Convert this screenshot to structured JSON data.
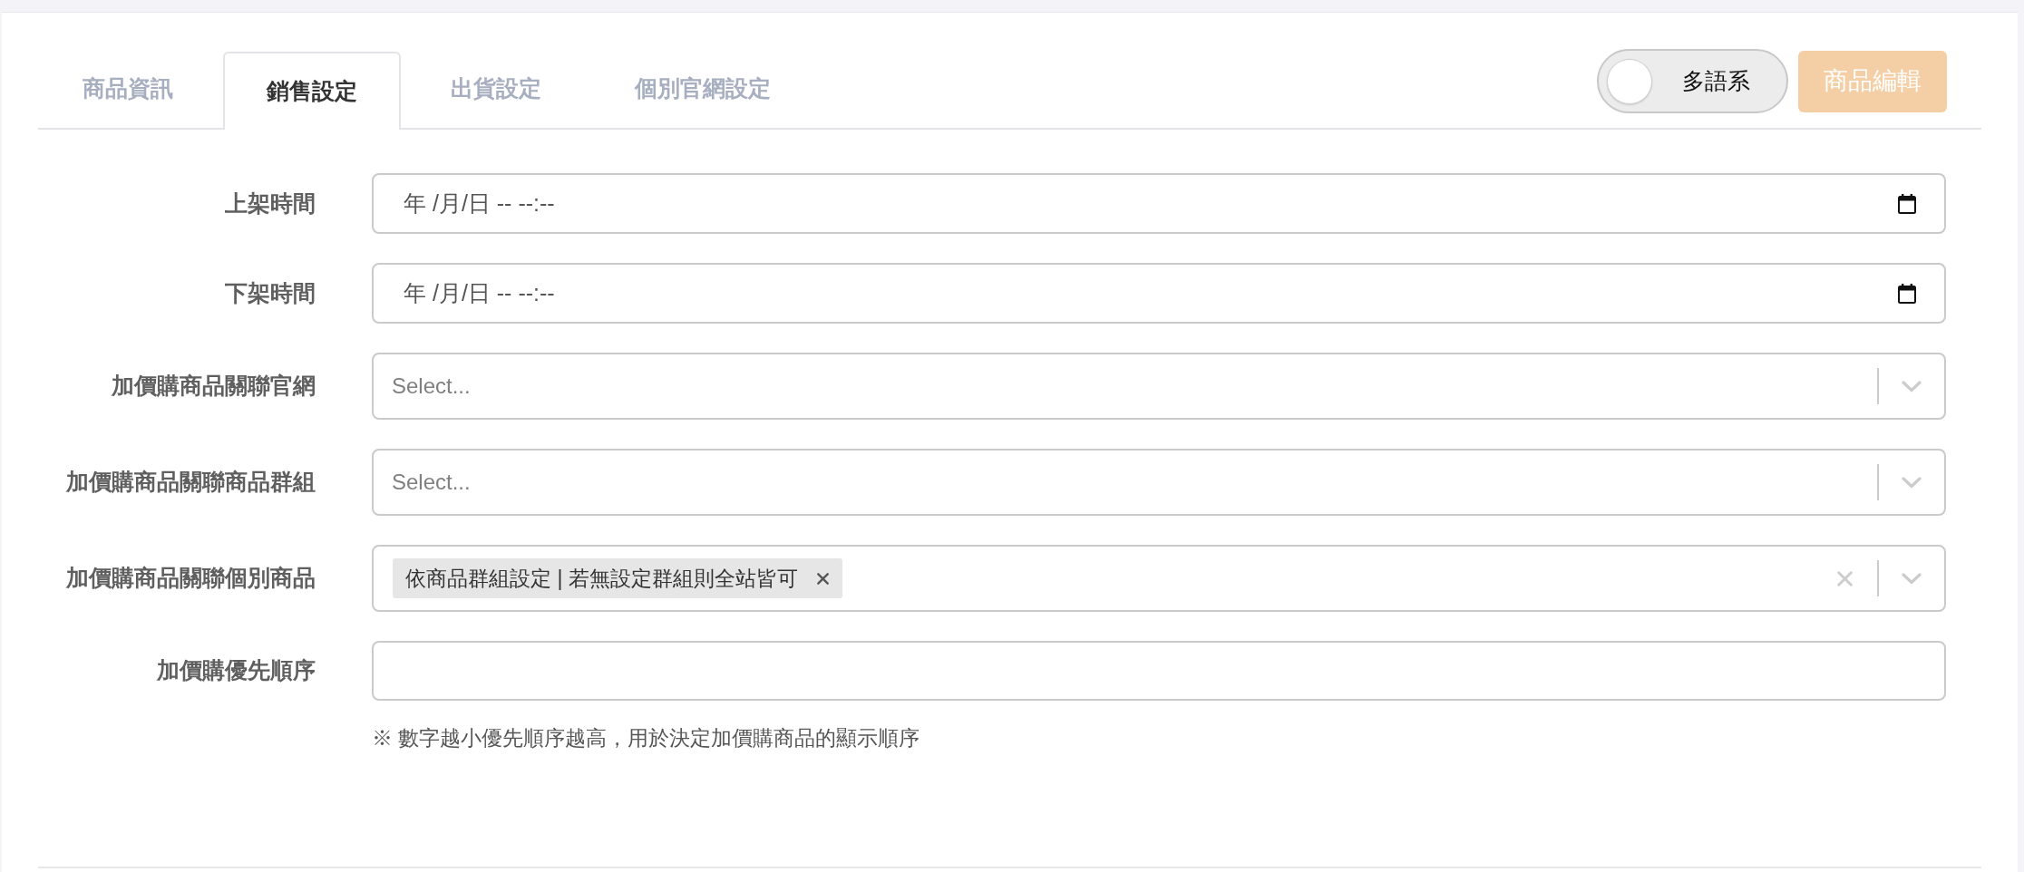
{
  "tabs": [
    {
      "label": "商品資訊",
      "selected": false
    },
    {
      "label": "銷售設定",
      "selected": true
    },
    {
      "label": "出貨設定",
      "selected": false
    },
    {
      "label": "個別官網設定",
      "selected": false
    }
  ],
  "language_toggle": {
    "label": "多語系",
    "on": false
  },
  "edit_button": {
    "label": "商品編輯",
    "disabled": true
  },
  "fields": [
    {
      "kind": "datetime",
      "label": "上架時間",
      "placeholder": "年 /月/日 -- --:--"
    },
    {
      "kind": "datetime",
      "label": "下架時間",
      "placeholder": "年 /月/日 -- --:--"
    },
    {
      "kind": "select",
      "label": "加價購商品關聯官網",
      "placeholder": "Select..."
    },
    {
      "kind": "select",
      "label": "加價購商品關聯商品群組",
      "placeholder": "Select..."
    },
    {
      "kind": "multiselect",
      "label": "加價購商品關聯個別商品",
      "tags": [
        "依商品群組設定 | 若無設定群組則全站皆可"
      ]
    },
    {
      "kind": "number",
      "label": "加價購優先順序",
      "hint": "※ 數字越小優先順序越高，用於決定加價購商品的顯示順序"
    }
  ]
}
